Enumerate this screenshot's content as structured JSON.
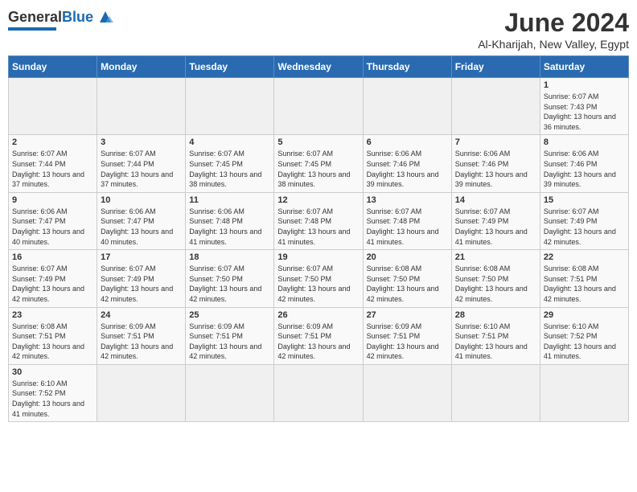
{
  "header": {
    "logo_general": "General",
    "logo_blue": "Blue",
    "month_title": "June 2024",
    "location": "Al-Kharijah, New Valley, Egypt"
  },
  "weekdays": [
    "Sunday",
    "Monday",
    "Tuesday",
    "Wednesday",
    "Thursday",
    "Friday",
    "Saturday"
  ],
  "weeks": [
    [
      {
        "day": "",
        "info": ""
      },
      {
        "day": "",
        "info": ""
      },
      {
        "day": "",
        "info": ""
      },
      {
        "day": "",
        "info": ""
      },
      {
        "day": "",
        "info": ""
      },
      {
        "day": "",
        "info": ""
      },
      {
        "day": "1",
        "info": "Sunrise: 6:07 AM\nSunset: 7:43 PM\nDaylight: 13 hours and 36 minutes."
      }
    ],
    [
      {
        "day": "2",
        "info": "Sunrise: 6:07 AM\nSunset: 7:44 PM\nDaylight: 13 hours and 37 minutes."
      },
      {
        "day": "3",
        "info": "Sunrise: 6:07 AM\nSunset: 7:44 PM\nDaylight: 13 hours and 37 minutes."
      },
      {
        "day": "4",
        "info": "Sunrise: 6:07 AM\nSunset: 7:45 PM\nDaylight: 13 hours and 38 minutes."
      },
      {
        "day": "5",
        "info": "Sunrise: 6:07 AM\nSunset: 7:45 PM\nDaylight: 13 hours and 38 minutes."
      },
      {
        "day": "6",
        "info": "Sunrise: 6:06 AM\nSunset: 7:46 PM\nDaylight: 13 hours and 39 minutes."
      },
      {
        "day": "7",
        "info": "Sunrise: 6:06 AM\nSunset: 7:46 PM\nDaylight: 13 hours and 39 minutes."
      },
      {
        "day": "8",
        "info": "Sunrise: 6:06 AM\nSunset: 7:46 PM\nDaylight: 13 hours and 39 minutes."
      }
    ],
    [
      {
        "day": "9",
        "info": "Sunrise: 6:06 AM\nSunset: 7:47 PM\nDaylight: 13 hours and 40 minutes."
      },
      {
        "day": "10",
        "info": "Sunrise: 6:06 AM\nSunset: 7:47 PM\nDaylight: 13 hours and 40 minutes."
      },
      {
        "day": "11",
        "info": "Sunrise: 6:06 AM\nSunset: 7:48 PM\nDaylight: 13 hours and 41 minutes."
      },
      {
        "day": "12",
        "info": "Sunrise: 6:07 AM\nSunset: 7:48 PM\nDaylight: 13 hours and 41 minutes."
      },
      {
        "day": "13",
        "info": "Sunrise: 6:07 AM\nSunset: 7:48 PM\nDaylight: 13 hours and 41 minutes."
      },
      {
        "day": "14",
        "info": "Sunrise: 6:07 AM\nSunset: 7:49 PM\nDaylight: 13 hours and 41 minutes."
      },
      {
        "day": "15",
        "info": "Sunrise: 6:07 AM\nSunset: 7:49 PM\nDaylight: 13 hours and 42 minutes."
      }
    ],
    [
      {
        "day": "16",
        "info": "Sunrise: 6:07 AM\nSunset: 7:49 PM\nDaylight: 13 hours and 42 minutes."
      },
      {
        "day": "17",
        "info": "Sunrise: 6:07 AM\nSunset: 7:49 PM\nDaylight: 13 hours and 42 minutes."
      },
      {
        "day": "18",
        "info": "Sunrise: 6:07 AM\nSunset: 7:50 PM\nDaylight: 13 hours and 42 minutes."
      },
      {
        "day": "19",
        "info": "Sunrise: 6:07 AM\nSunset: 7:50 PM\nDaylight: 13 hours and 42 minutes."
      },
      {
        "day": "20",
        "info": "Sunrise: 6:08 AM\nSunset: 7:50 PM\nDaylight: 13 hours and 42 minutes."
      },
      {
        "day": "21",
        "info": "Sunrise: 6:08 AM\nSunset: 7:50 PM\nDaylight: 13 hours and 42 minutes."
      },
      {
        "day": "22",
        "info": "Sunrise: 6:08 AM\nSunset: 7:51 PM\nDaylight: 13 hours and 42 minutes."
      }
    ],
    [
      {
        "day": "23",
        "info": "Sunrise: 6:08 AM\nSunset: 7:51 PM\nDaylight: 13 hours and 42 minutes."
      },
      {
        "day": "24",
        "info": "Sunrise: 6:09 AM\nSunset: 7:51 PM\nDaylight: 13 hours and 42 minutes."
      },
      {
        "day": "25",
        "info": "Sunrise: 6:09 AM\nSunset: 7:51 PM\nDaylight: 13 hours and 42 minutes."
      },
      {
        "day": "26",
        "info": "Sunrise: 6:09 AM\nSunset: 7:51 PM\nDaylight: 13 hours and 42 minutes."
      },
      {
        "day": "27",
        "info": "Sunrise: 6:09 AM\nSunset: 7:51 PM\nDaylight: 13 hours and 42 minutes."
      },
      {
        "day": "28",
        "info": "Sunrise: 6:10 AM\nSunset: 7:51 PM\nDaylight: 13 hours and 41 minutes."
      },
      {
        "day": "29",
        "info": "Sunrise: 6:10 AM\nSunset: 7:52 PM\nDaylight: 13 hours and 41 minutes."
      }
    ],
    [
      {
        "day": "30",
        "info": "Sunrise: 6:10 AM\nSunset: 7:52 PM\nDaylight: 13 hours and 41 minutes."
      },
      {
        "day": "",
        "info": ""
      },
      {
        "day": "",
        "info": ""
      },
      {
        "day": "",
        "info": ""
      },
      {
        "day": "",
        "info": ""
      },
      {
        "day": "",
        "info": ""
      },
      {
        "day": "",
        "info": ""
      }
    ]
  ]
}
